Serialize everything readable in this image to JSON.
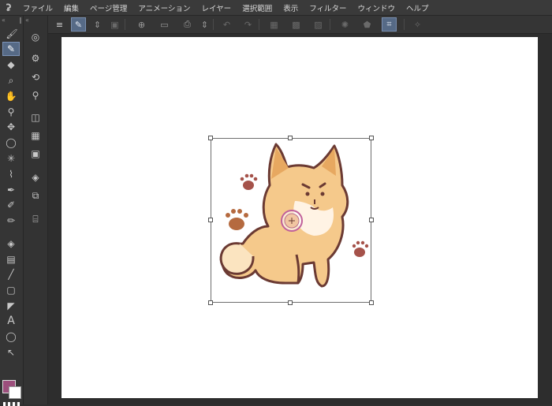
{
  "menu": {
    "logo": "ʡ",
    "items": [
      "ファイル",
      "編集",
      "ページ管理",
      "アニメーション",
      "レイヤー",
      "選択範囲",
      "表示",
      "フィルター",
      "ウィンドウ",
      "ヘルプ"
    ]
  },
  "toolbar": {
    "icons": [
      "menu-icon",
      "pen-pressure-icon",
      "up-down-icon",
      "new-page-icon",
      "new-canvas-icon",
      "open-file-icon",
      "save-icon",
      "print-icon",
      "up-down-icon",
      "undo-icon",
      "redo-icon",
      "layer-a-icon",
      "layer-b-icon",
      "layer-c-icon",
      "color-settings-icon",
      "fill-icon",
      "transform-icon",
      "sparkle-icon"
    ]
  },
  "tools": [
    "brush-icon",
    "eraser-icon",
    "zoom-icon",
    "hand-icon",
    "select-object-icon",
    "move-icon",
    "lasso-icon",
    "magic-wand-icon",
    "eyedropper-icon",
    "pen-icon",
    "pencil-icon",
    "marker-icon",
    "fill-bucket-icon",
    "gradient-icon",
    "line-icon",
    "frame-icon",
    "ruler-icon",
    "text-icon",
    "balloon-icon",
    "correction-icon"
  ],
  "subtools": [
    "navigator-icon",
    "layer-property-icon",
    "transform-sub-icon",
    "layer-search-icon",
    "material-icon",
    "timeline-icon",
    "tone-icon",
    "layers-icon",
    "stack-icon",
    "camera-icon"
  ],
  "colors": {
    "foreground": "#9c4f7c",
    "background": "#ffffff",
    "accent": "#566a86"
  }
}
